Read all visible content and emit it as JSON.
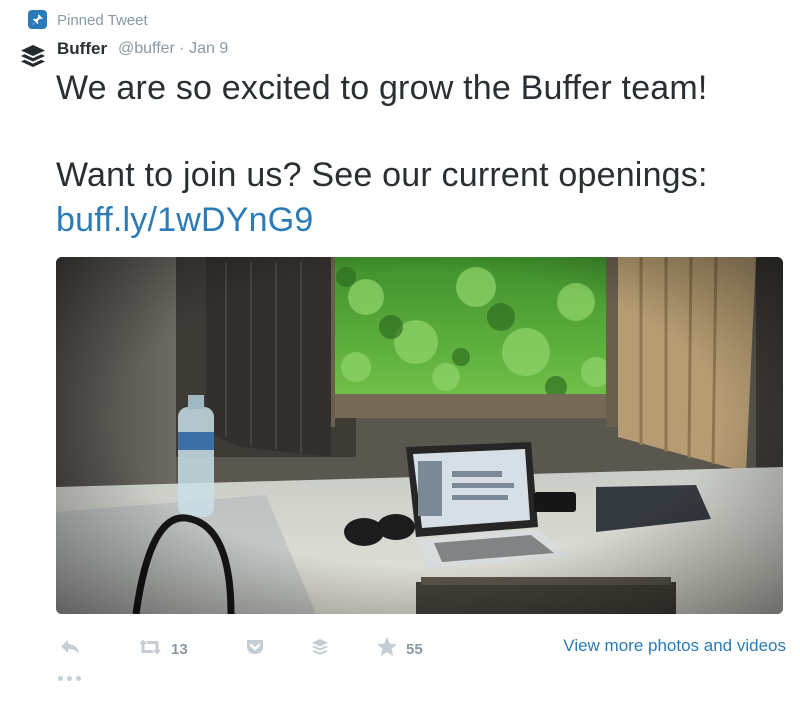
{
  "pinned": {
    "label": "Pinned Tweet",
    "icon": "pin-icon"
  },
  "tweet": {
    "author_name": "Buffer",
    "author_handle": "@buffer",
    "separator": "·",
    "date": "Jan 9",
    "avatar_icon": "buffer-logo-icon",
    "text_line1": "We are so excited to grow the Buffer team!",
    "text_line2": "Want to join us? See our current openings:",
    "link": "buff.ly/1wDYnG9"
  },
  "actions": {
    "reply_icon": "reply-icon",
    "retweet_icon": "retweet-icon",
    "retweet_count": "13",
    "pocket_icon": "pocket-icon",
    "buffer_icon": "buffer-icon",
    "favorite_icon": "star-icon",
    "favorite_count": "55",
    "more_icon": "ellipsis-icon",
    "view_more_label": "View more photos and videos"
  },
  "colors": {
    "text": "#292f33",
    "muted": "#8899a6",
    "link": "#2b7bb9",
    "action_icon": "#c4ced6"
  }
}
